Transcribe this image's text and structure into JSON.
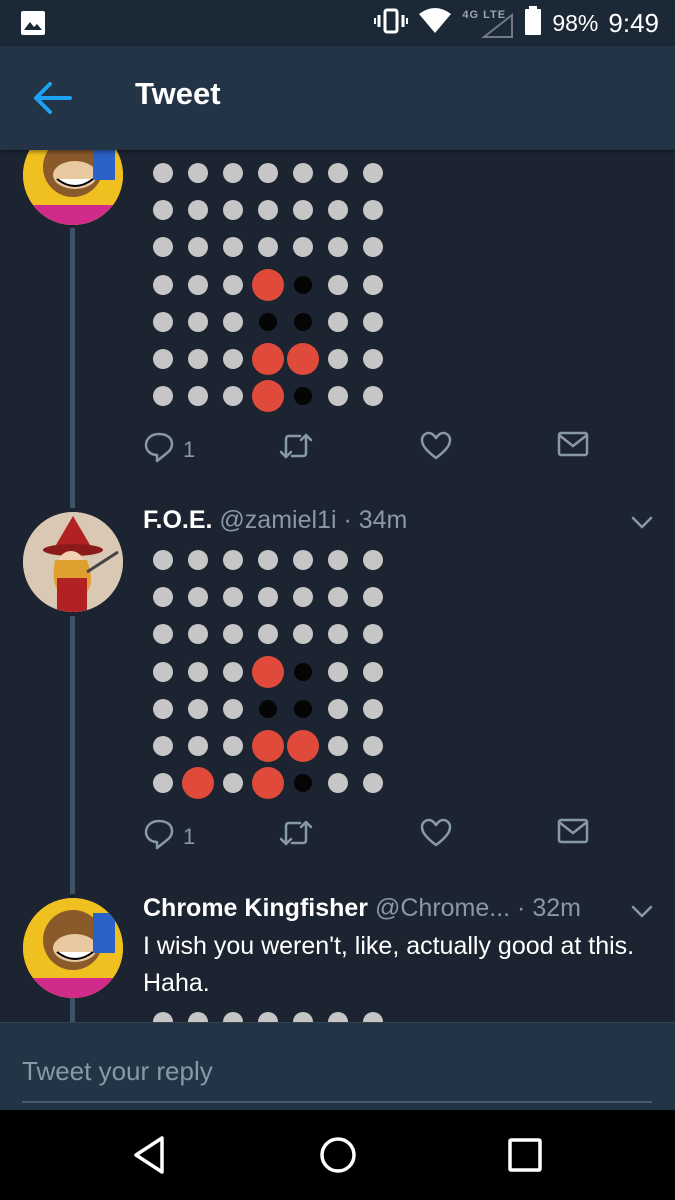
{
  "status": {
    "battery": "98%",
    "time": "9:49",
    "network": "4G LTE"
  },
  "appbar": {
    "title": "Tweet"
  },
  "colors": {
    "background": "#1b2430",
    "appbar": "#243447",
    "accent": "#1da1f2",
    "red": "#e04a3b",
    "gray_dot": "#c6c6c6"
  },
  "tweets": [
    {
      "id": "t1",
      "grid": [
        "ggggggg",
        "ggggggg",
        "ggggggg",
        "gggrbgg",
        "gggbbgg",
        "gggrrgg",
        "gggrbgg"
      ],
      "replies": "1"
    },
    {
      "id": "t2",
      "name": "F.O.E.",
      "handle": "@zamiel1i · 34m",
      "grid": [
        "ggggggg",
        "ggggggg",
        "ggggggg",
        "gggrbgg",
        "gggbbgg",
        "gggrrgg",
        "grgrbgg"
      ],
      "replies": "1"
    },
    {
      "id": "t3",
      "name": "Chrome Kingfisher",
      "handle": "@Chrome... · 32m",
      "text": "I wish you weren't, like, actually good at this. Haha."
    }
  ],
  "reply": {
    "placeholder": "Tweet your reply"
  },
  "icons": {
    "back": "back-arrow-icon",
    "reply": "reply-icon",
    "retweet": "retweet-icon",
    "like": "heart-icon",
    "dm": "mail-icon",
    "chevron": "chevron-down-icon"
  }
}
